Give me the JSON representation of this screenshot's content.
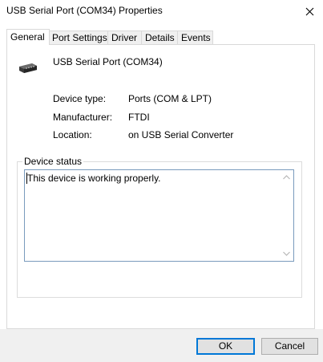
{
  "window": {
    "title": "USB Serial Port (COM34) Properties",
    "close_icon": "close-icon"
  },
  "tabs": [
    {
      "label": "General",
      "active": true
    },
    {
      "label": "Port Settings",
      "active": false
    },
    {
      "label": "Driver",
      "active": false
    },
    {
      "label": "Details",
      "active": false
    },
    {
      "label": "Events",
      "active": false
    }
  ],
  "device": {
    "icon": "serial-port-icon",
    "name": "USB Serial Port (COM34)",
    "properties": [
      {
        "label": "Device type:",
        "value": "Ports (COM & LPT)"
      },
      {
        "label": "Manufacturer:",
        "value": "FTDI"
      },
      {
        "label": "Location:",
        "value": "on USB Serial Converter"
      }
    ]
  },
  "status": {
    "group_label": "Device status",
    "text": "This device is working properly."
  },
  "buttons": {
    "ok": "OK",
    "cancel": "Cancel"
  },
  "colors": {
    "focus_border": "#0078d7",
    "textbox_border": "#7a9bbd"
  }
}
